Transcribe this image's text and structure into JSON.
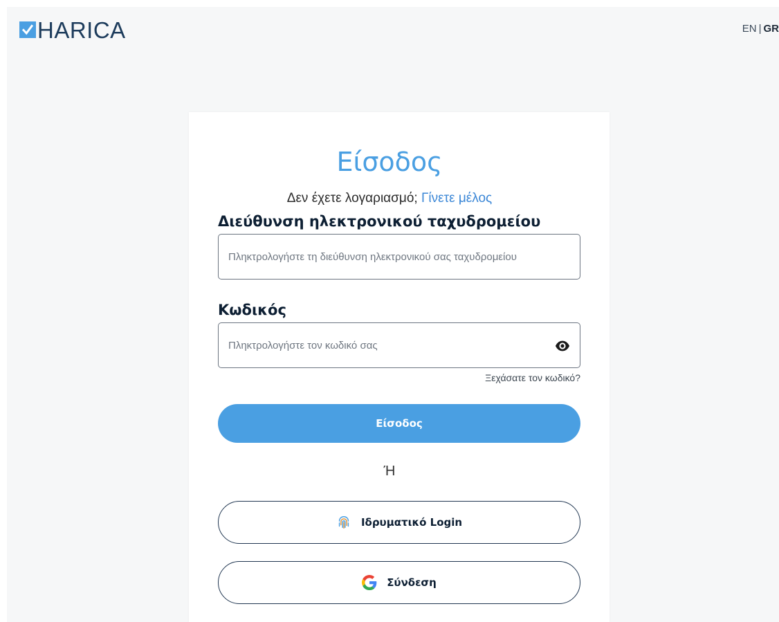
{
  "header": {
    "logo_text": "HARICA",
    "lang_en": "EN",
    "lang_separator": "|",
    "lang_gr": "GR"
  },
  "login": {
    "title": "Είσοδος",
    "no_account_text": "Δεν έχετε λογαριασμό;",
    "signup_link": "Γίνετε μέλος",
    "email_label": "Διεύθυνση ηλεκτρονικού ταχυδρομείου",
    "email_placeholder": "Πληκτρολογήστε τη διεύθυνση ηλεκτρονικού σας ταχυδρομείου",
    "email_value": "",
    "password_label": "Κωδικός",
    "password_placeholder": "Πληκτρολογήστε τον κωδικό σας",
    "password_value": "",
    "forgot_link": "Ξεχάσατε τον κωδικό?",
    "submit_label": "Είσοδος",
    "or_text": "Ή",
    "institutional_login_label": "Ιδρυματικό Login",
    "google_login_label": "Σύνδεση"
  },
  "colors": {
    "accent": "#4a9fe2",
    "link": "#3a86d6",
    "dark_text": "#0d1f33",
    "button_border": "#1f3550"
  },
  "icons": {
    "logo": "check-square-icon",
    "password_toggle": "eye-icon",
    "institutional": "fingerprint-icon",
    "google": "google-icon"
  }
}
